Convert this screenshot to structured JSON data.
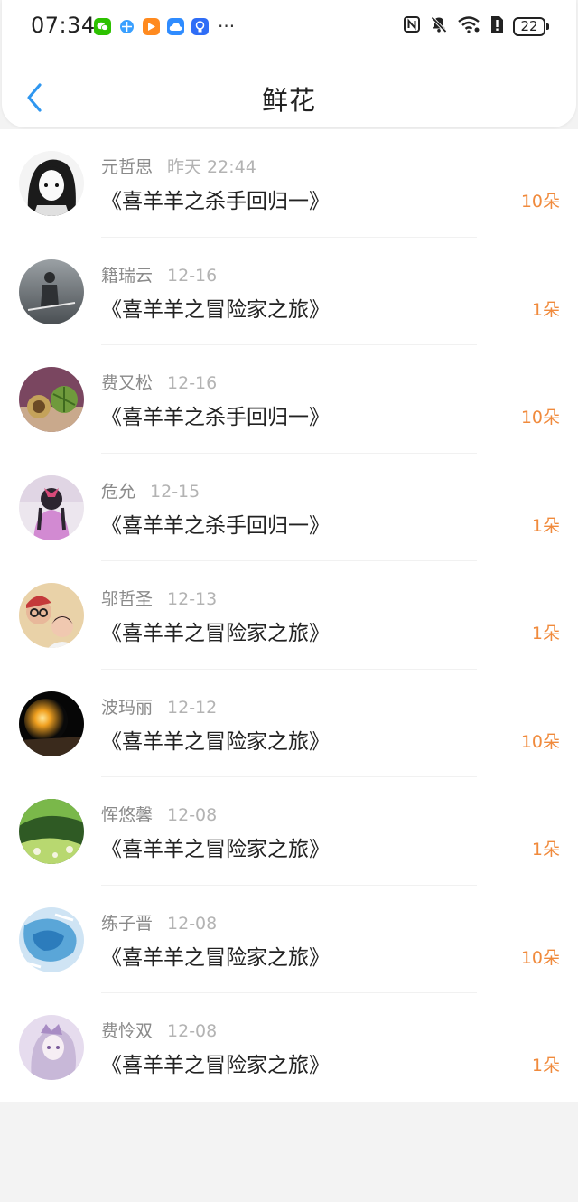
{
  "status_bar": {
    "time": "07:34",
    "battery": "22",
    "app_icons": [
      {
        "name": "wechat-icon",
        "color": "#2dc100"
      },
      {
        "name": "browser-icon",
        "color": "#3aa0ff"
      },
      {
        "name": "video-icon",
        "color": "#ff8a1f"
      },
      {
        "name": "weather-icon",
        "color": "#2f8cff"
      },
      {
        "name": "bulb-icon",
        "color": "#2f6df6"
      }
    ],
    "more": "···"
  },
  "header": {
    "title": "鲜花"
  },
  "colors": {
    "accent": "#2f97f0",
    "amount": "#f08a3c"
  },
  "records": [
    {
      "name": "元哲思",
      "date": "昨天 22:44",
      "book": "《喜羊羊之杀手回归一》",
      "amount": "10朵"
    },
    {
      "name": "籍瑞云",
      "date": "12-16",
      "book": "《喜羊羊之冒险家之旅》",
      "amount": "1朵"
    },
    {
      "name": "费又松",
      "date": "12-16",
      "book": "《喜羊羊之杀手回归一》",
      "amount": "10朵"
    },
    {
      "name": "危允",
      "date": "12-15",
      "book": "《喜羊羊之杀手回归一》",
      "amount": "1朵"
    },
    {
      "name": "邬哲圣",
      "date": "12-13",
      "book": "《喜羊羊之冒险家之旅》",
      "amount": "1朵"
    },
    {
      "name": "波玛丽",
      "date": "12-12",
      "book": "《喜羊羊之冒险家之旅》",
      "amount": "10朵"
    },
    {
      "name": "恽悠馨",
      "date": "12-08",
      "book": "《喜羊羊之冒险家之旅》",
      "amount": "1朵"
    },
    {
      "name": "练子晋",
      "date": "12-08",
      "book": "《喜羊羊之冒险家之旅》",
      "amount": "10朵"
    },
    {
      "name": "费怜双",
      "date": "12-08",
      "book": "《喜羊羊之冒险家之旅》",
      "amount": "1朵"
    }
  ]
}
